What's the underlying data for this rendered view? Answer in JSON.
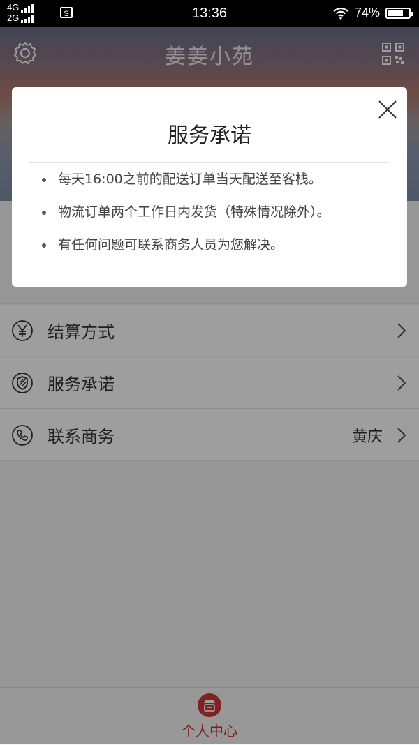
{
  "status_bar": {
    "network1": "4G",
    "network2": "2G",
    "sim_icon": "S",
    "time": "13:36",
    "battery": "74%",
    "battery_level": 0.74
  },
  "header": {
    "title": "姜姜小苑",
    "left_icon": "gear-icon",
    "right_icon": "qr-code-icon"
  },
  "menu": {
    "items": [
      {
        "label": "结算方式",
        "value": "",
        "icon": "yen-icon"
      },
      {
        "label": "服务承诺",
        "value": "",
        "icon": "shield-icon"
      },
      {
        "label": "联系商务",
        "value": "黄庆",
        "icon": "phone-icon"
      }
    ]
  },
  "tabbar": {
    "active_tab": "个人中心",
    "accent": "#c83438"
  },
  "modal": {
    "title": "服务承诺",
    "points": [
      "每天16:00之前的配送订单当天配送至客栈。",
      "物流订单两个工作日内发货（特殊情况除外）。",
      "有任何问题可联系商务人员为您解决。"
    ]
  }
}
